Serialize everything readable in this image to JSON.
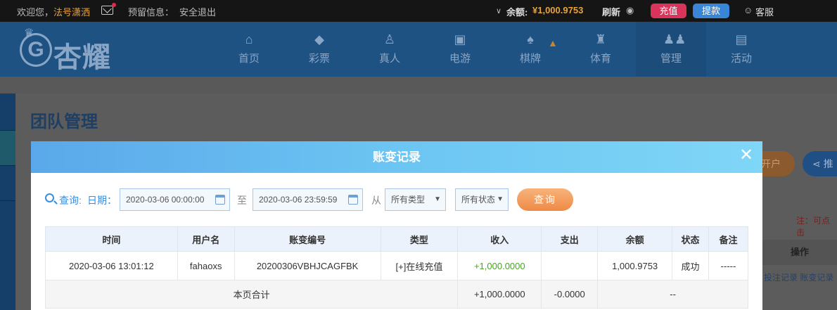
{
  "topbar": {
    "welcome": "欢迎您，",
    "username": "法号潇洒",
    "reserve_label": "预留信息：",
    "logout": "安全退出",
    "balance_label": "余额:",
    "balance_value": "¥1,000.9753",
    "refresh": "刷新",
    "deposit": "充值",
    "withdraw": "提款",
    "service": "客服"
  },
  "logo": {
    "text": "杏耀",
    "mark": "G"
  },
  "nav": [
    {
      "label": "首页",
      "icon": "home-icon"
    },
    {
      "label": "彩票",
      "icon": "ticket-icon"
    },
    {
      "label": "真人",
      "icon": "person-icon"
    },
    {
      "label": "电游",
      "icon": "arcade-icon"
    },
    {
      "label": "棋牌",
      "icon": "cards-icon"
    },
    {
      "label": "体育",
      "icon": "trophy-icon"
    },
    {
      "label": "管理",
      "icon": "users-icon"
    },
    {
      "label": "活动",
      "icon": "gift-icon"
    }
  ],
  "page": {
    "title": "团队管理",
    "btn_open": "开户",
    "btn_promo": "推",
    "note": "注：可点击",
    "op_header": "操作",
    "op_link1": "投注记录",
    "op_link2": "账变记录"
  },
  "modal": {
    "title": "账变记录",
    "query_label": "查询:",
    "date_label": "日期：",
    "date_from": "2020-03-06 00:00:00",
    "to_label": "至",
    "date_to": "2020-03-06 23:59:59",
    "from_label": "从",
    "type_select": "所有类型",
    "status_select": "所有状态",
    "query_button": "查询",
    "columns": [
      "时间",
      "用户名",
      "账变编号",
      "类型",
      "收入",
      "支出",
      "余额",
      "状态",
      "备注"
    ],
    "rows": [
      [
        "2020-03-06 13:01:12",
        "fahaoxs",
        "20200306VBHJCAGFBK",
        "[+]在线充值",
        "+1,000.0000",
        "",
        "1,000.9753",
        "成功",
        "-----"
      ]
    ],
    "summary": {
      "label": "本页合计",
      "income": "+1,000.0000",
      "expense": "-0.0000",
      "rest": "--"
    }
  },
  "colors": {
    "accent": "#3a8ee0",
    "income": "#4aa32a",
    "balance": "#e8a33c",
    "deposit": "#d9345a",
    "withdraw": "#3a86d6"
  }
}
